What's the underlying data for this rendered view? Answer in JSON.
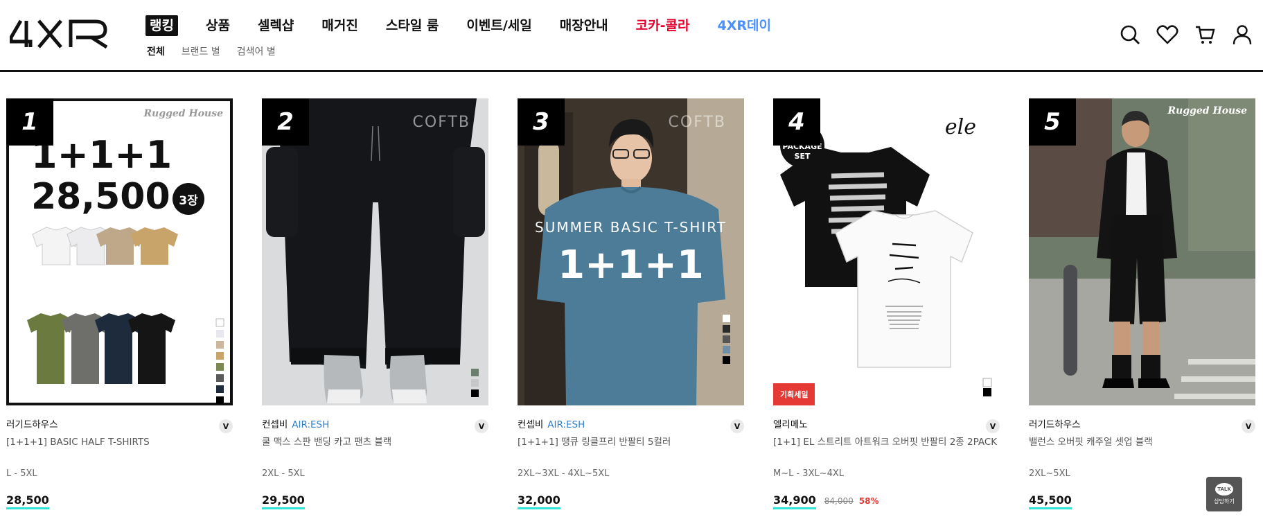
{
  "brand_logo": "4XR",
  "nav": {
    "items": [
      "랭킹",
      "상품",
      "셀렉샵",
      "매거진",
      "스타일 룸",
      "이벤트/세일",
      "매장안내",
      "코카-콜라",
      "4XR데이"
    ],
    "item_colors": [
      "#ffffff",
      "#111111",
      "#111111",
      "#111111",
      "#111111",
      "#111111",
      "#111111",
      "#e4002b",
      "#4a90ff"
    ],
    "active": "랭킹"
  },
  "subnav": {
    "items": [
      "전체",
      "브랜드 별",
      "검색어 별"
    ],
    "active": "전체"
  },
  "header_icons": [
    "search-icon",
    "heart-icon",
    "cart-icon",
    "user-icon"
  ],
  "products": [
    {
      "rank": "1",
      "brand": "러기드하우스",
      "sub_brand": "",
      "name": "[1+1+1] BASIC HALF T-SHIRTS",
      "sizes": "L - 5XL",
      "price": "28,500",
      "original_price": "",
      "discount": "",
      "badge": ""
    },
    {
      "rank": "2",
      "brand": "컨셉비",
      "sub_brand": "AIR:ESH",
      "name": "쿨 맥스 스판 밴딩 카고 팬츠 블랙",
      "sizes": "2XL - 5XL",
      "price": "29,500",
      "original_price": "",
      "discount": "",
      "badge": ""
    },
    {
      "rank": "3",
      "brand": "컨셉비",
      "sub_brand": "AIR:ESH",
      "name": "[1+1+1] 땡큐 링클프리 반팔티 5컬러",
      "sizes": "2XL~3XL - 4XL~5XL",
      "price": "32,000",
      "original_price": "",
      "discount": "",
      "badge": ""
    },
    {
      "rank": "4",
      "brand": "엘리메노",
      "sub_brand": "",
      "name": "[1+1] EL 스트리트 아트워크 오버핏 반팔티 2종 2PACK",
      "sizes": "M~L - 3XL~4XL",
      "price": "34,900",
      "original_price": "84,000",
      "discount": "58%",
      "badge": "기획세일"
    },
    {
      "rank": "5",
      "brand": "러기드하우스",
      "sub_brand": "",
      "name": "밸런스 오버핏 캐주얼 셋업 블랙",
      "sizes": "2XL~5XL",
      "price": "45,500",
      "original_price": "",
      "discount": "",
      "badge": ""
    }
  ],
  "image_text": {
    "p1_brand": "Rugged House",
    "p1_promo": "1+1+1",
    "p1_price": "28,500",
    "p1_count": "3장",
    "p2_mark": "COFTB",
    "p3_mark": "COFTB",
    "p3_title": "SUMMER BASIC T-SHIRT",
    "p3_promo": "1+1+1",
    "p4_badge": "PACKAGE SET",
    "p4_mark": "ele",
    "p5_brand": "Rugged House"
  },
  "talk_button": {
    "icon": "TALK",
    "label": "상담하기"
  }
}
